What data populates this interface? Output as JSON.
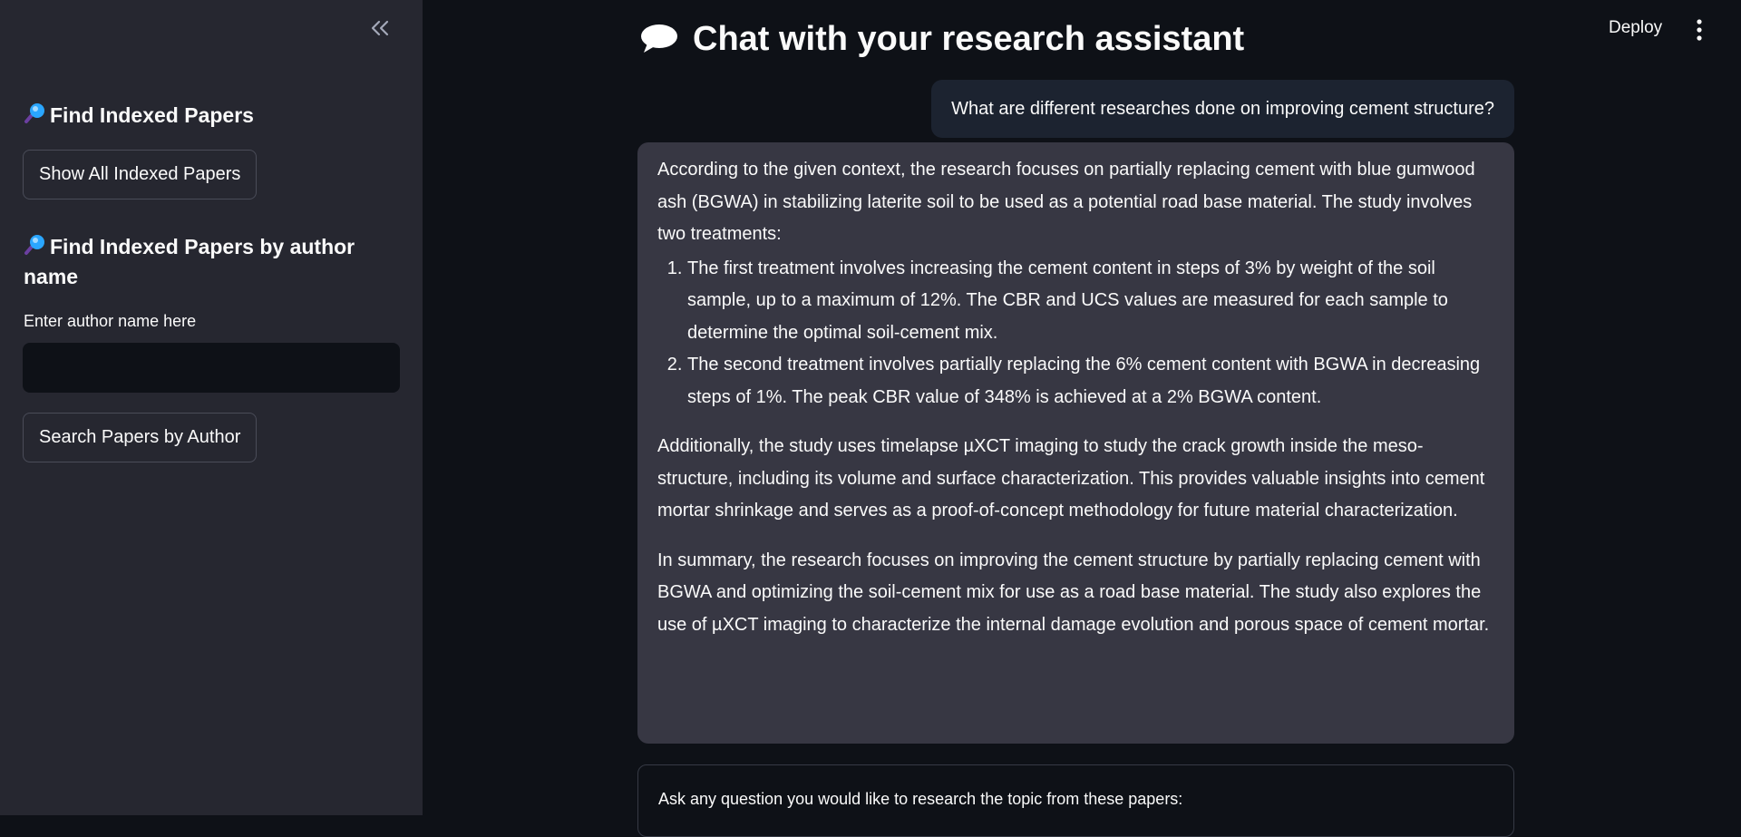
{
  "sidebar": {
    "collapse_icon": "chevrons-left-icon",
    "find_heading": "Find Indexed Papers",
    "show_all_label": "Show All Indexed Papers",
    "author_heading": "Find Indexed Papers by author name",
    "author_input_label": "Enter author name here",
    "author_input_value": "",
    "search_label": "Search Papers by Author",
    "heading_icon": "magnifying-glass-icon"
  },
  "header": {
    "deploy_label": "Deploy",
    "menu_icon": "kebab-menu-icon"
  },
  "main": {
    "title": "Chat with your research assistant",
    "title_icon": "speech-bubble-icon",
    "messages": [
      {
        "role": "user",
        "text": "What are different researches done on improving cement structure?"
      },
      {
        "role": "assistant",
        "intro": "According to the given context, the research focuses on partially replacing cement with blue gumwood ash (BGWA) in stabilizing laterite soil to be used as a potential road base material. The study involves two treatments:",
        "list": [
          "The first treatment involves increasing the cement content in steps of 3% by weight of the soil sample, up to a maximum of 12%. The CBR and UCS values are measured for each sample to determine the optimal soil-cement mix.",
          "The second treatment involves partially replacing the 6% cement content with BGWA in decreasing steps of 1%. The peak CBR value of 348% is achieved at a 2% BGWA content."
        ],
        "para2": "Additionally, the study uses timelapse µXCT imaging to study the crack growth inside the meso-structure, including its volume and surface characterization. This provides valuable insights into cement mortar shrinkage and serves as a proof-of-concept methodology for future material characterization.",
        "para3": "In summary, the research focuses on improving the cement structure by partially replacing cement with BGWA and optimizing the soil-cement mix for use as a road base material. The study also explores the use of µXCT imaging to characterize the internal damage evolution and porous space of cement mortar."
      }
    ],
    "question_label": "Ask any question you would like to research the topic from these papers:"
  },
  "colors": {
    "background": "#0e1117",
    "sidebar": "#262730",
    "assistant_bubble": "#373743",
    "user_bubble": "#1c2330",
    "text": "#fafafa"
  }
}
